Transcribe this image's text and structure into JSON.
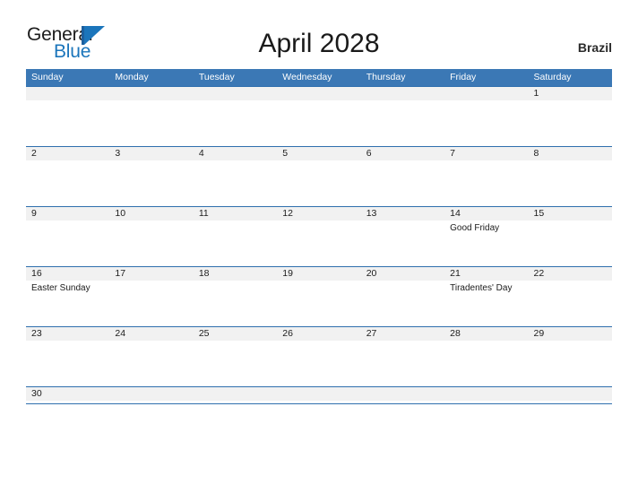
{
  "brand": {
    "word1": "General",
    "word2": "Blue",
    "flag_icon": "flag-triangle-icon"
  },
  "header": {
    "title": "April 2028",
    "country": "Brazil"
  },
  "colors": {
    "header_blue": "#3b78b5",
    "band_gray": "#f1f1f1",
    "rule_blue": "#2f6fae",
    "brand_blue": "#1b75bb",
    "text": "#1b1b1b"
  },
  "calendar": {
    "weekday_headers": [
      "Sunday",
      "Monday",
      "Tuesday",
      "Wednesday",
      "Thursday",
      "Friday",
      "Saturday"
    ],
    "weeks": [
      {
        "days": [
          {
            "num": "",
            "event": ""
          },
          {
            "num": "",
            "event": ""
          },
          {
            "num": "",
            "event": ""
          },
          {
            "num": "",
            "event": ""
          },
          {
            "num": "",
            "event": ""
          },
          {
            "num": "",
            "event": ""
          },
          {
            "num": "1",
            "event": ""
          }
        ]
      },
      {
        "days": [
          {
            "num": "2",
            "event": ""
          },
          {
            "num": "3",
            "event": ""
          },
          {
            "num": "4",
            "event": ""
          },
          {
            "num": "5",
            "event": ""
          },
          {
            "num": "6",
            "event": ""
          },
          {
            "num": "7",
            "event": ""
          },
          {
            "num": "8",
            "event": ""
          }
        ]
      },
      {
        "days": [
          {
            "num": "9",
            "event": ""
          },
          {
            "num": "10",
            "event": ""
          },
          {
            "num": "11",
            "event": ""
          },
          {
            "num": "12",
            "event": ""
          },
          {
            "num": "13",
            "event": ""
          },
          {
            "num": "14",
            "event": "Good Friday"
          },
          {
            "num": "15",
            "event": ""
          }
        ]
      },
      {
        "days": [
          {
            "num": "16",
            "event": "Easter Sunday"
          },
          {
            "num": "17",
            "event": ""
          },
          {
            "num": "18",
            "event": ""
          },
          {
            "num": "19",
            "event": ""
          },
          {
            "num": "20",
            "event": ""
          },
          {
            "num": "21",
            "event": "Tiradentes' Day"
          },
          {
            "num": "22",
            "event": ""
          }
        ]
      },
      {
        "days": [
          {
            "num": "23",
            "event": ""
          },
          {
            "num": "24",
            "event": ""
          },
          {
            "num": "25",
            "event": ""
          },
          {
            "num": "26",
            "event": ""
          },
          {
            "num": "27",
            "event": ""
          },
          {
            "num": "28",
            "event": ""
          },
          {
            "num": "29",
            "event": ""
          }
        ]
      },
      {
        "days": [
          {
            "num": "30",
            "event": ""
          },
          {
            "num": "",
            "event": ""
          },
          {
            "num": "",
            "event": ""
          },
          {
            "num": "",
            "event": ""
          },
          {
            "num": "",
            "event": ""
          },
          {
            "num": "",
            "event": ""
          },
          {
            "num": "",
            "event": ""
          }
        ]
      }
    ]
  }
}
